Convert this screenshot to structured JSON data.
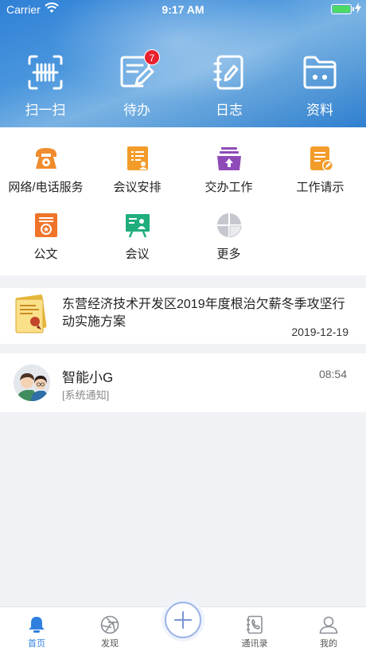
{
  "status_bar": {
    "carrier": "Carrier",
    "time": "9:17 AM"
  },
  "quick_actions": [
    {
      "label": "扫一扫",
      "icon": "scan-icon"
    },
    {
      "label": "待办",
      "icon": "todo-icon",
      "badge": "7"
    },
    {
      "label": "日志",
      "icon": "journal-icon"
    },
    {
      "label": "资料",
      "icon": "folder-icon"
    }
  ],
  "services": [
    {
      "label": "网络/电话服务",
      "icon": "phone-icon",
      "color": "#f08c2d"
    },
    {
      "label": "会议安排",
      "icon": "meeting-schedule-icon",
      "color": "#f39c2a"
    },
    {
      "label": "交办工作",
      "icon": "assign-work-icon",
      "color": "#8e4bb8"
    },
    {
      "label": "工作请示",
      "icon": "work-request-icon",
      "color": "#f39c2a"
    },
    {
      "label": "公文",
      "icon": "document-icon",
      "color": "#f0742a"
    },
    {
      "label": "会议",
      "icon": "meeting-icon",
      "color": "#1fae7c"
    },
    {
      "label": "更多",
      "icon": "more-icon",
      "color": "#c8ccd2"
    }
  ],
  "notice": {
    "title": "东营经济技术开发区2019年度根治欠薪冬季攻坚行动实施方案",
    "date": "2019-12-19"
  },
  "message": {
    "name": "智能小G",
    "time": "08:54",
    "subtitle": "[系统通知]"
  },
  "tabbar": [
    {
      "label": "首页",
      "icon": "bell-icon",
      "active": true
    },
    {
      "label": "发现",
      "icon": "aperture-icon"
    },
    {
      "label": "",
      "icon": "plus-icon"
    },
    {
      "label": "通讯录",
      "icon": "contacts-icon"
    },
    {
      "label": "我的",
      "icon": "user-icon"
    }
  ],
  "colors": {
    "accent": "#2f7fe0",
    "badge": "#e8212e"
  }
}
